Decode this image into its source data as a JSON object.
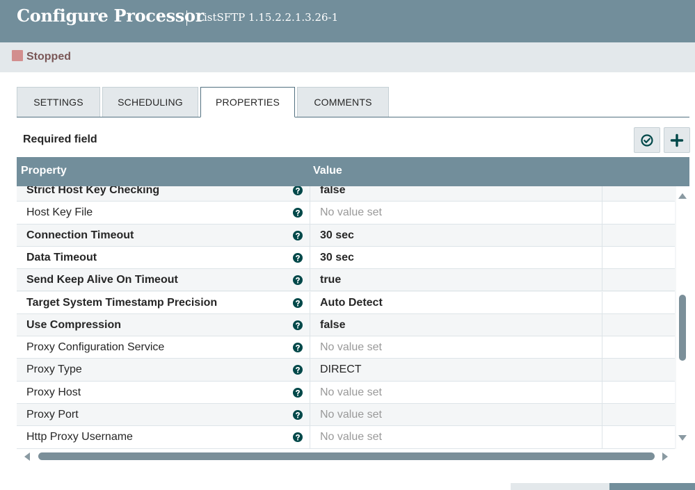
{
  "dialog": {
    "title": "Configure Processor",
    "subtitle": "ListSFTP 1.15.2.2.1.3.26-1"
  },
  "status": {
    "label": "Stopped",
    "color": "#d28e8e"
  },
  "tabs": [
    {
      "label": "SETTINGS",
      "active": false
    },
    {
      "label": "SCHEDULING",
      "active": false
    },
    {
      "label": "PROPERTIES",
      "active": true
    },
    {
      "label": "COMMENTS",
      "active": false
    }
  ],
  "properties_panel": {
    "required_label": "Required field",
    "verify_icon": "check-circle-icon",
    "add_icon": "plus-icon"
  },
  "grid": {
    "columns": {
      "property": "Property",
      "value": "Value"
    },
    "rows": [
      {
        "name": "Strict Host Key Checking",
        "required": true,
        "value": "false",
        "is_set": true
      },
      {
        "name": "Host Key File",
        "required": false,
        "value": "No value set",
        "is_set": false
      },
      {
        "name": "Connection Timeout",
        "required": true,
        "value": "30 sec",
        "is_set": true
      },
      {
        "name": "Data Timeout",
        "required": true,
        "value": "30 sec",
        "is_set": true
      },
      {
        "name": "Send Keep Alive On Timeout",
        "required": true,
        "value": "true",
        "is_set": true
      },
      {
        "name": "Target System Timestamp Precision",
        "required": true,
        "value": "Auto Detect",
        "is_set": true
      },
      {
        "name": "Use Compression",
        "required": true,
        "value": "false",
        "is_set": true
      },
      {
        "name": "Proxy Configuration Service",
        "required": false,
        "value": "No value set",
        "is_set": false
      },
      {
        "name": "Proxy Type",
        "required": false,
        "value": "DIRECT",
        "is_set": true
      },
      {
        "name": "Proxy Host",
        "required": false,
        "value": "No value set",
        "is_set": false
      },
      {
        "name": "Proxy Port",
        "required": false,
        "value": "No value set",
        "is_set": false
      },
      {
        "name": "Http Proxy Username",
        "required": false,
        "value": "No value set",
        "is_set": false
      }
    ]
  },
  "colors": {
    "header": "#728e9b",
    "help_icon": "#004849"
  }
}
